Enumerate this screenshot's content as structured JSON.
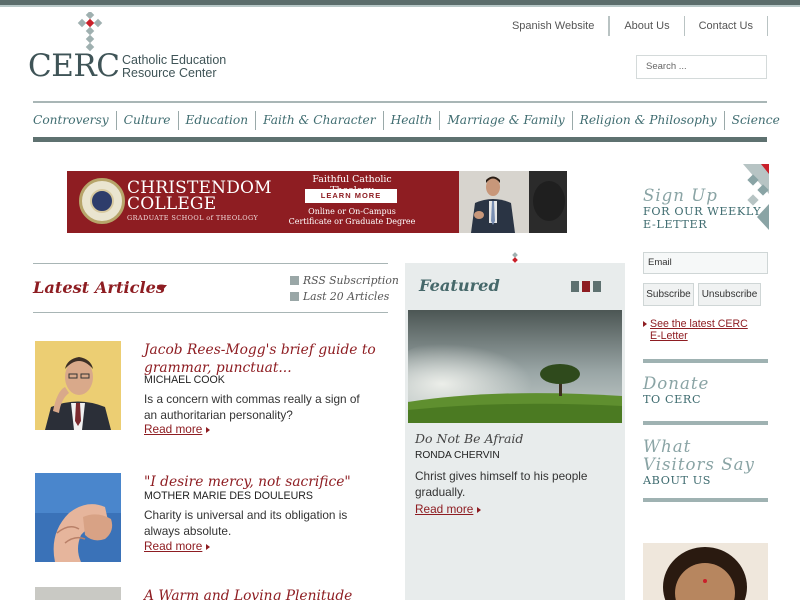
{
  "header": {
    "logo_word": "CERC",
    "logo_sub_line1": "Catholic Education",
    "logo_sub_line2": "Resource Center",
    "links": [
      "Spanish Website",
      "About Us",
      "Contact Us"
    ],
    "search_placeholder": "Search ..."
  },
  "nav": {
    "items": [
      "Controversy",
      "Culture",
      "Education",
      "Faith & Character",
      "Health",
      "Marriage & Family",
      "Religion & Philosophy",
      "Science"
    ]
  },
  "banner": {
    "title": "CHRISTENDOM COLLEGE",
    "subtitle": "GRADUATE SCHOOL of THEOLOGY",
    "heading": "Faithful Catholic Theology",
    "button": "LEARN MORE",
    "tagline1": "Online or On-Campus",
    "tagline2": "Certificate or Graduate Degree"
  },
  "latest": {
    "title": "Latest Articles",
    "rss": "RSS Subscription",
    "last20": "Last 20 Articles",
    "articles": [
      {
        "title": "Jacob Rees-Mogg's brief guide to grammar, punctuat...",
        "author": "MICHAEL COOK",
        "desc": "Is a concern with commas really a sign of an authoritarian personality?",
        "more": "Read more"
      },
      {
        "title": "\"I desire mercy, not sacrifice\"",
        "author": "MOTHER MARIE DES DOULEURS",
        "desc": "Charity is universal and its obligation is always absolute.",
        "more": "Read more"
      },
      {
        "title": "A Warm and Loving Plenitude",
        "author": "",
        "desc": "",
        "more": ""
      }
    ]
  },
  "featured": {
    "title": "Featured",
    "headline": "Do Not Be Afraid",
    "author": "RONDA CHERVIN",
    "desc": "Christ gives himself to his people gradually.",
    "more": "Read more"
  },
  "sidebar": {
    "signup_big": "Sign Up",
    "signup_small1": "FOR OUR WEEKLY",
    "signup_small2": "E-LETTER",
    "email_placeholder": "Email",
    "subscribe": "Subscribe",
    "unsubscribe": "Unsubscribe",
    "latest_letter1": "See the latest CERC",
    "latest_letter2": "E-Letter",
    "donate_big": "Donate",
    "donate_small": "TO CERC",
    "visitors_big1": "What",
    "visitors_big2": "Visitors Say",
    "visitors_small": "ABOUT US"
  },
  "colors": {
    "accent_red": "#8e1d22",
    "teal_dark": "#3f6c70",
    "teal_light": "#8aa4a5",
    "bar_gray": "#5e7170"
  }
}
